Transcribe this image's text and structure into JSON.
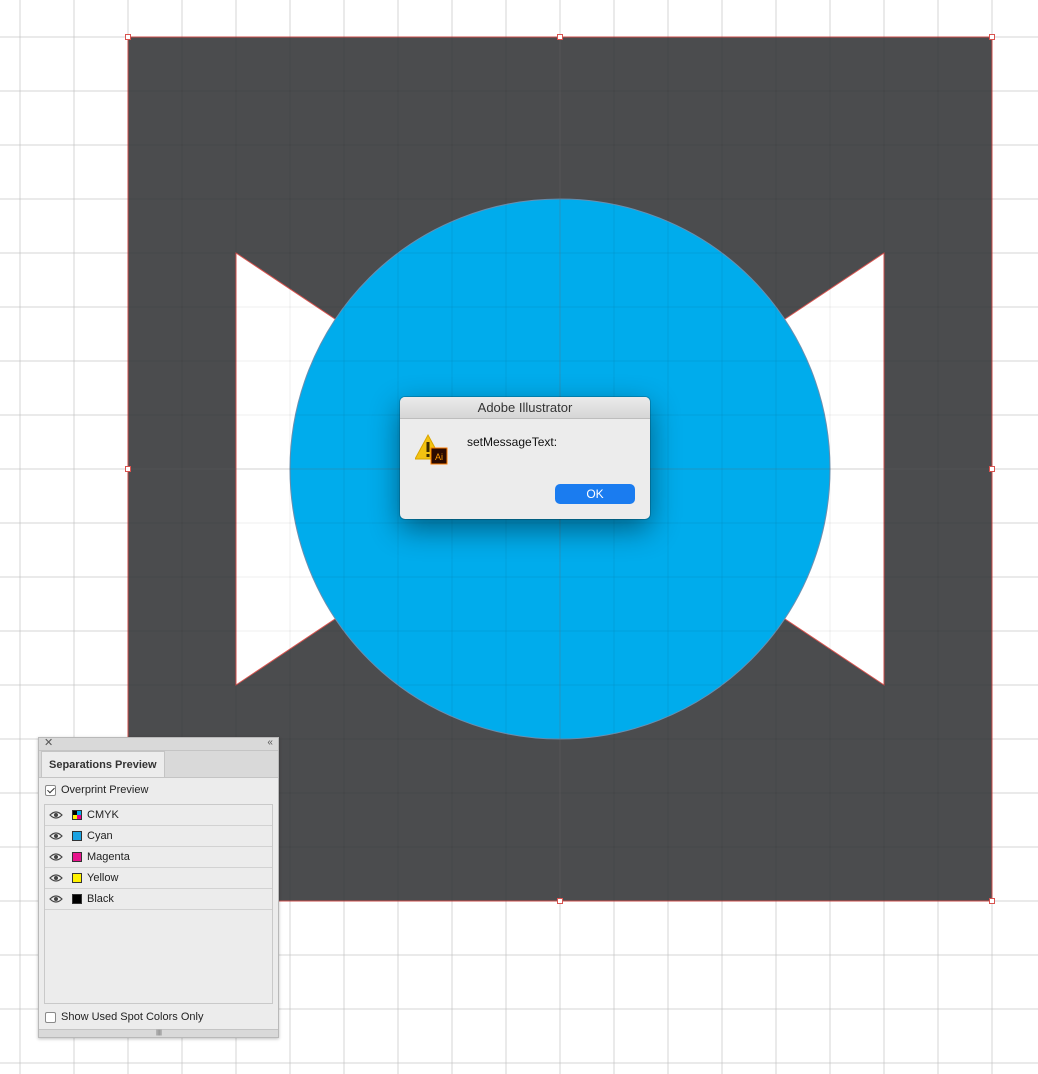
{
  "artwork": {
    "background_color": "#4b4c4e",
    "circle_color": "#00acec",
    "notch_color": "#ffffff",
    "selection_color": "#d9534f",
    "grid_color": "#e4e4e4"
  },
  "dialog": {
    "title": "Adobe Illustrator",
    "message": "setMessageText:",
    "ok_label": "OK",
    "icon": "warning-icon",
    "app_badge": "Ai"
  },
  "separations_panel": {
    "tab_label": "Separations Preview",
    "overprint_preview": {
      "label": "Overprint Preview",
      "checked": true
    },
    "separations": [
      {
        "label": "CMYK",
        "color": "composite",
        "visible": true
      },
      {
        "label": "Cyan",
        "color": "#1ba3e2",
        "visible": true
      },
      {
        "label": "Magenta",
        "color": "#e6148c",
        "visible": true
      },
      {
        "label": "Yellow",
        "color": "#fff200",
        "visible": true
      },
      {
        "label": "Black",
        "color": "#000000",
        "visible": true
      }
    ],
    "show_spot_only": {
      "label": "Show Used Spot Colors Only",
      "checked": false
    }
  }
}
